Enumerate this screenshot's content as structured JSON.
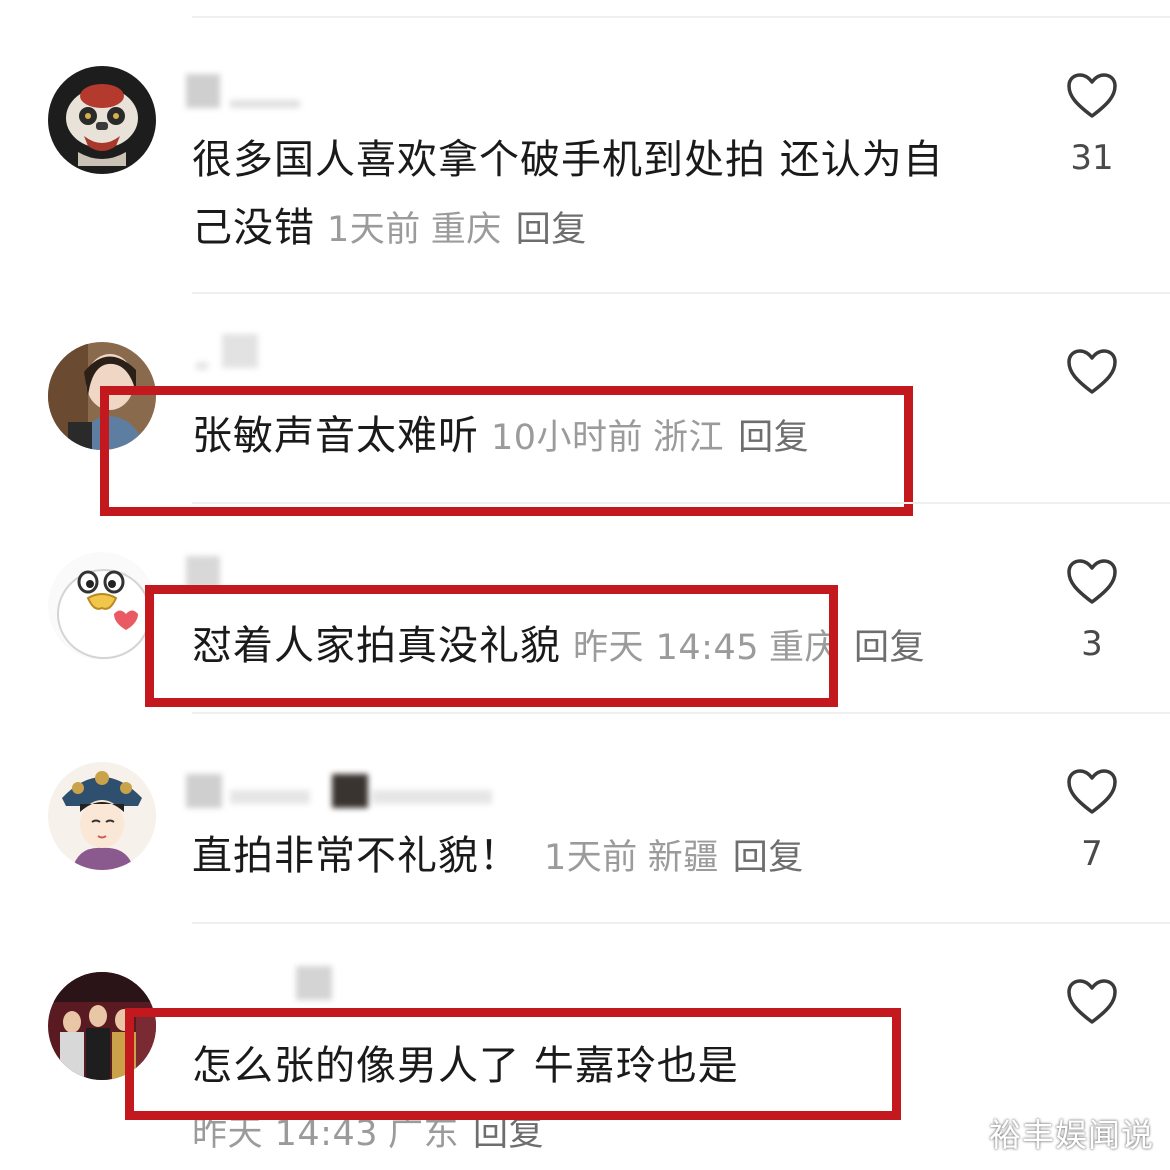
{
  "comments": [
    {
      "text_line1": "很多国人喜欢拿个破手机到处拍 还认为自",
      "text_line2": "己没错",
      "time": "1天前",
      "location": "重庆",
      "reply": "回复",
      "likes": "31"
    },
    {
      "text": "张敏声音太难听",
      "time": "10小时前",
      "location": "浙江",
      "reply": "回复",
      "likes": ""
    },
    {
      "text": "怼着人家拍真没礼貌",
      "time": "昨天 14:45",
      "location": "重庆",
      "reply": "回复",
      "likes": "3"
    },
    {
      "text": "直拍非常不礼貌！",
      "time": "1天前",
      "location": "新疆",
      "reply": "回复",
      "likes": "7"
    },
    {
      "text": "怎么张的像男人了 牛嘉玲也是",
      "time": "昨天 14:43",
      "location": "广东",
      "reply": "回复",
      "likes": ""
    }
  ],
  "watermark": "裕丰娱闻说",
  "colors": {
    "highlight": "#c4181f",
    "text": "#1a1a1a",
    "meta": "#9b9b9b"
  },
  "icons": {
    "like": "heart-outline-icon"
  }
}
